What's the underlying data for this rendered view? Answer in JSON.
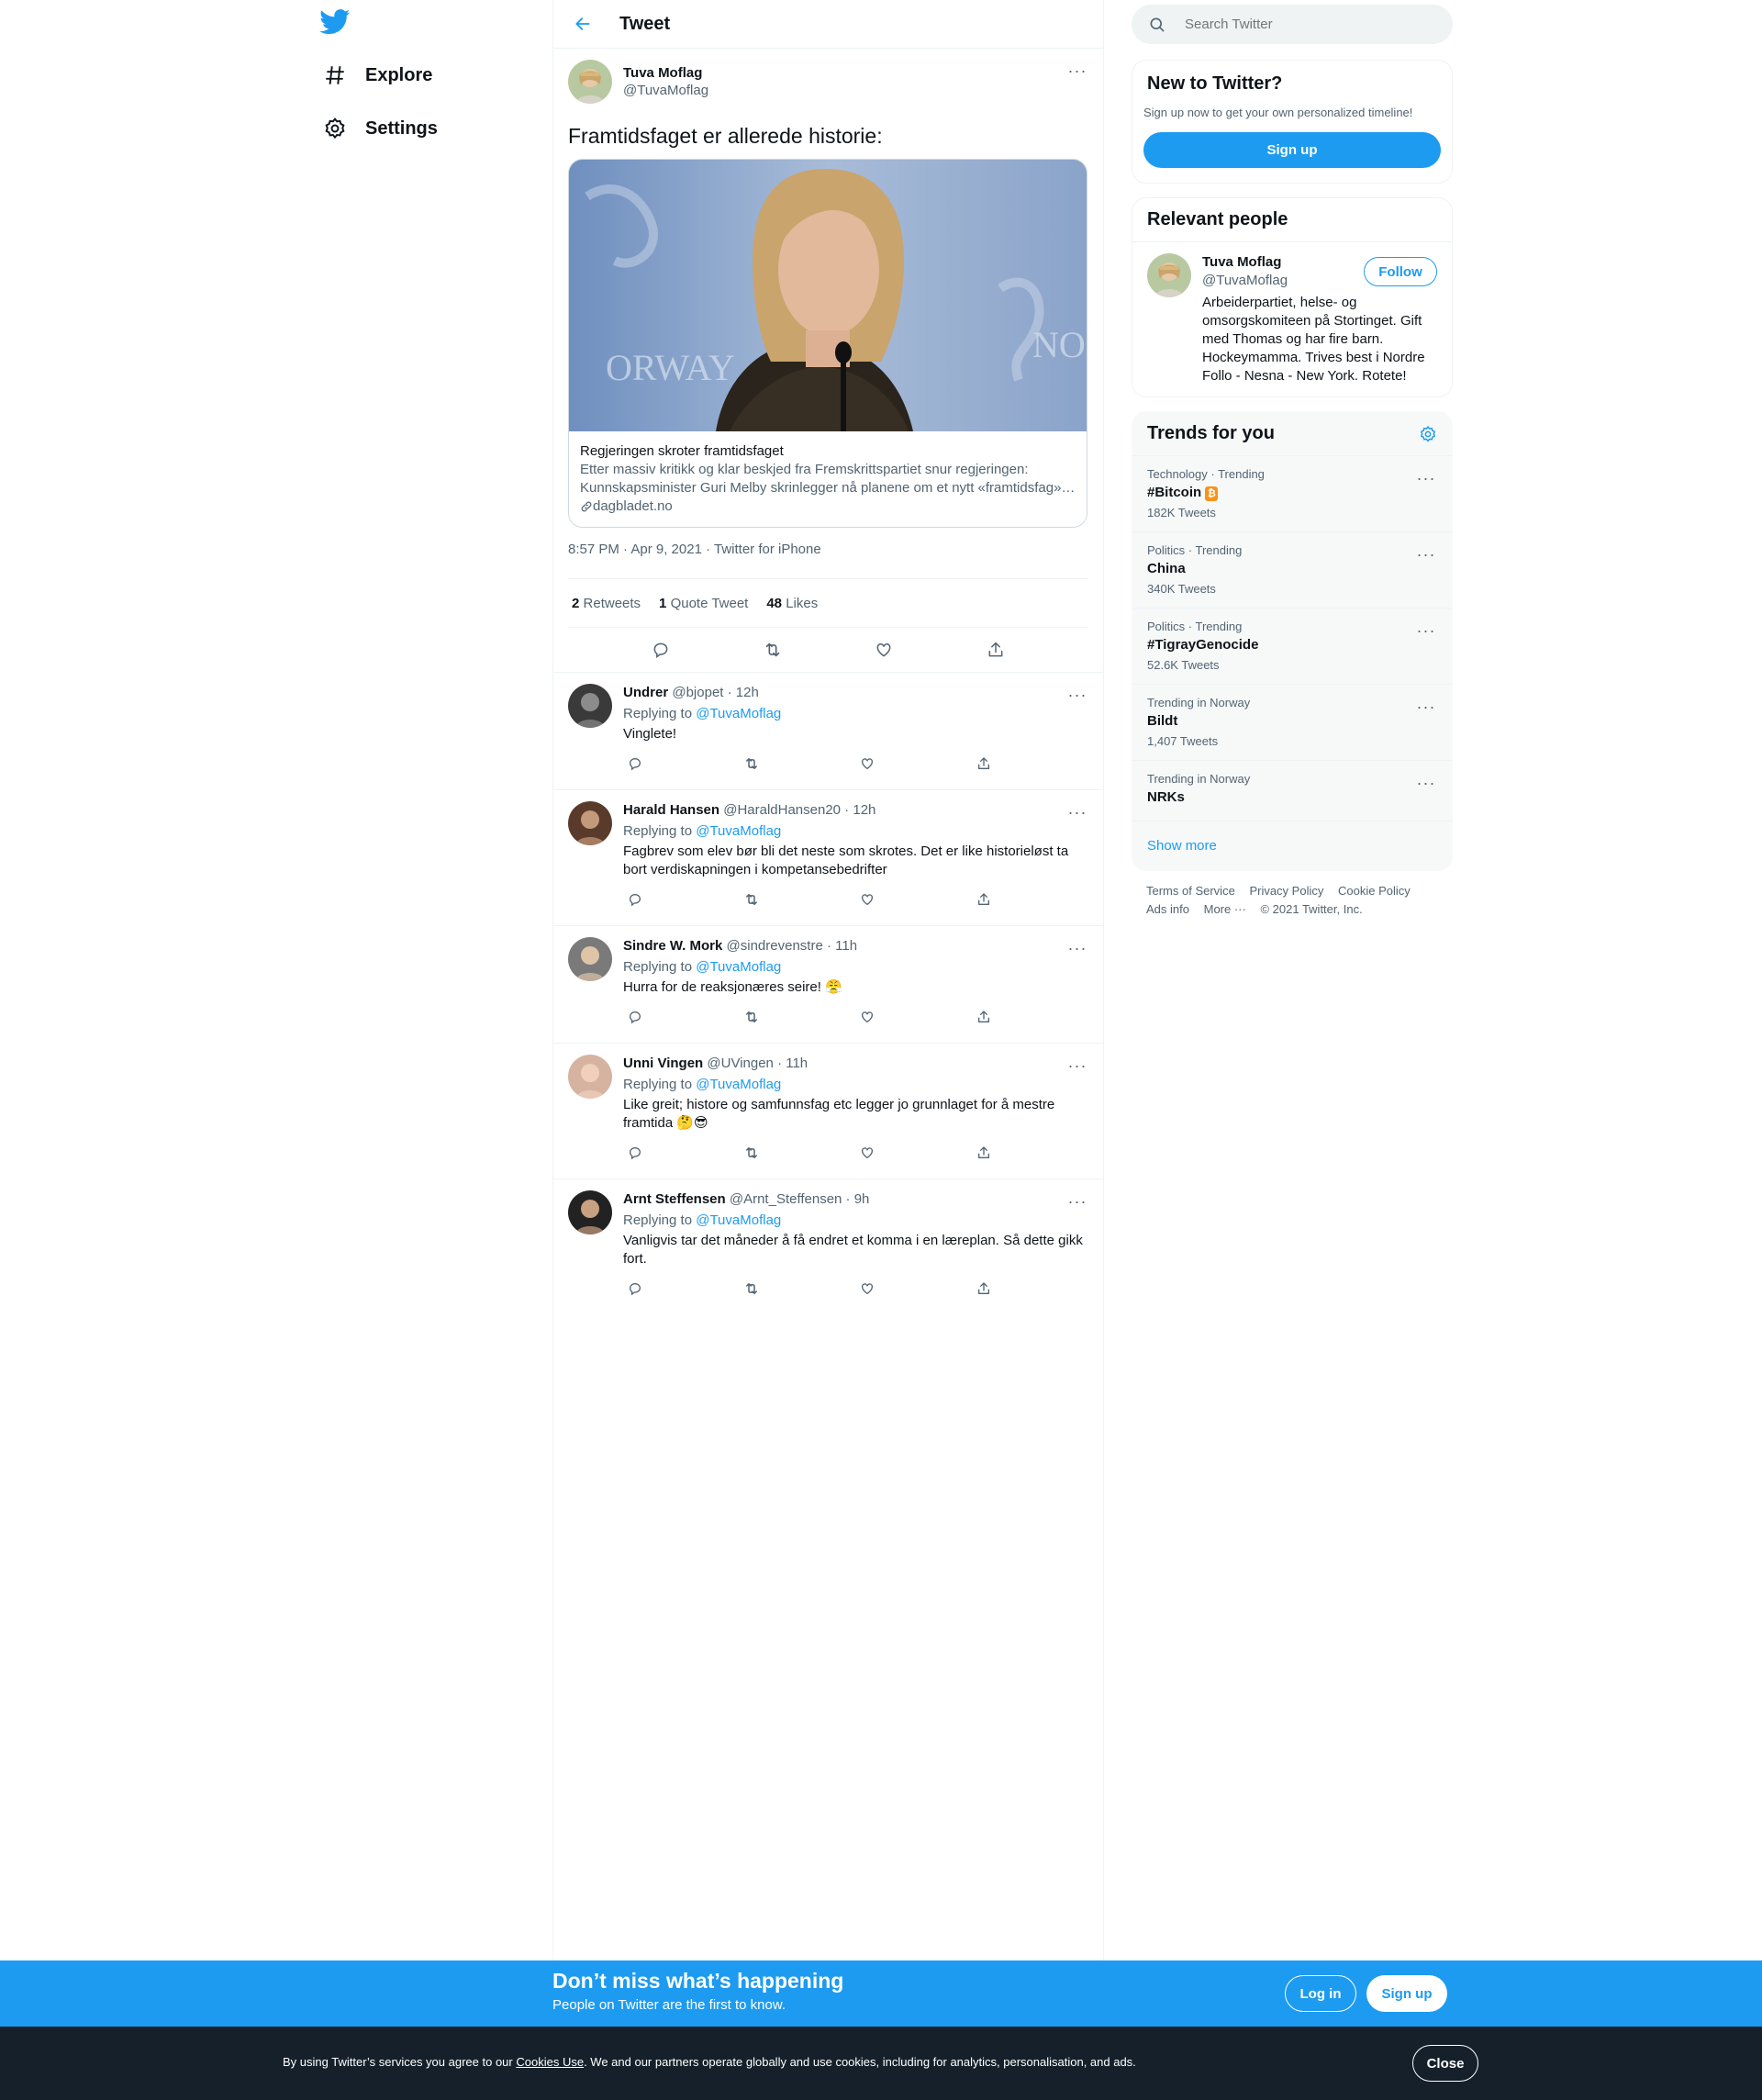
{
  "nav": {
    "logo_icon": "twitter-bird-icon",
    "items": [
      {
        "label": "Explore",
        "icon": "hashtag-icon"
      },
      {
        "label": "Settings",
        "icon": "gear-icon"
      }
    ]
  },
  "header": {
    "title": "Tweet"
  },
  "tweet": {
    "author_name": "Tuva Moflag",
    "author_handle": "@TuvaMoflag",
    "text": "Framtidsfaget er allerede historie:",
    "card": {
      "title": "Regjeringen skroter framtidsfaget",
      "description": "Etter massiv kritikk og klar beskjed fra Fremskrittspartiet snur regjeringen: Kunnskapsminister Guri Melby skrinlegger nå planene om et nytt «framtidsfag»…",
      "domain": "dagbladet.no"
    },
    "timestamp": "8:57 PM · Apr 9, 2021 · Twitter for iPhone",
    "stats": {
      "retweets_count": "2",
      "retweets_label": "Retweets",
      "quotes_count": "1",
      "quotes_label": "Quote Tweet",
      "likes_count": "48",
      "likes_label": "Likes"
    }
  },
  "replies": [
    {
      "name": "Undrer",
      "handle": "@bjopet · 12h",
      "replying_prefix": "Replying to",
      "replying_to": "@TuvaMoflag",
      "text": "Vinglete!"
    },
    {
      "name": "Harald Hansen",
      "handle": "@HaraldHansen20 · 12h",
      "replying_prefix": "Replying to",
      "replying_to": "@TuvaMoflag",
      "text": "Fagbrev som elev bør bli det neste som skrotes. Det er like historieløst ta bort verdiskapningen i kompetansebedrifter"
    },
    {
      "name": "Sindre W. Mork",
      "handle": "@sindrevenstre · 11h",
      "replying_prefix": "Replying to",
      "replying_to": "@TuvaMoflag",
      "text": "Hurra for de reaksjonæres seire! 😤"
    },
    {
      "name": "Unni Vingen",
      "handle": "@UVingen · 11h",
      "replying_prefix": "Replying to",
      "replying_to": "@TuvaMoflag",
      "text": "Like greit; histore og samfunnsfag etc legger jo grunnlaget for å mestre framtida  🤔😎"
    },
    {
      "name": "Arnt Steffensen",
      "handle": "@Arnt_Steffensen · 9h",
      "replying_prefix": "Replying to",
      "replying_to": "@TuvaMoflag",
      "text": "Vanligvis tar det måneder å få endret et komma i en læreplan. Så dette gikk fort."
    }
  ],
  "search": {
    "placeholder": "Search Twitter"
  },
  "new_to_twitter": {
    "title": "New to Twitter?",
    "subtitle": "Sign up now to get your own personalized timeline!",
    "button": "Sign up"
  },
  "relevant_people": {
    "title": "Relevant people",
    "person": {
      "name": "Tuva Moflag",
      "handle": "@TuvaMoflag",
      "bio": "Arbeiderpartiet, helse- og omsorgskomiteen på Stortinget. Gift med Thomas og har fire barn. Hockeymamma. Trives best i Nordre Follo - Nesna - New York. Rotete!",
      "follow_label": "Follow"
    }
  },
  "trends": {
    "title": "Trends for you",
    "items": [
      {
        "meta": "Technology · Trending",
        "name": "#Bitcoin",
        "count": "182K Tweets"
      },
      {
        "meta": "Politics · Trending",
        "name": "China",
        "count": "340K Tweets"
      },
      {
        "meta": "Politics · Trending",
        "name": "#TigrayGenocide",
        "count": "52.6K Tweets"
      },
      {
        "meta": "Trending in Norway",
        "name": "Bildt",
        "count": "1,407 Tweets"
      },
      {
        "meta": "Trending in Norway",
        "name": "NRKs",
        "count": ""
      }
    ],
    "show_more": "Show more"
  },
  "footer": {
    "links": [
      "Terms of Service",
      "Privacy Policy",
      "Cookie Policy",
      "Ads info",
      "More ···"
    ],
    "copyright": "© 2021 Twitter, Inc."
  },
  "bottom_bar": {
    "title": "Don’t miss what’s happening",
    "subtitle": "People on Twitter are the first to know.",
    "login": "Log in",
    "signup": "Sign up"
  },
  "cookie": {
    "prefix": "By using Twitter’s services you agree to our ",
    "link": "Cookies Use",
    "suffix": ". We and our partners operate globally and use cookies, including for analytics, personalisation, and ads.",
    "close": "Close"
  },
  "colors": {
    "accent": "#1d9bf0",
    "text": "#0f1419",
    "muted": "#536471",
    "cookie_bg": "#15202b"
  }
}
